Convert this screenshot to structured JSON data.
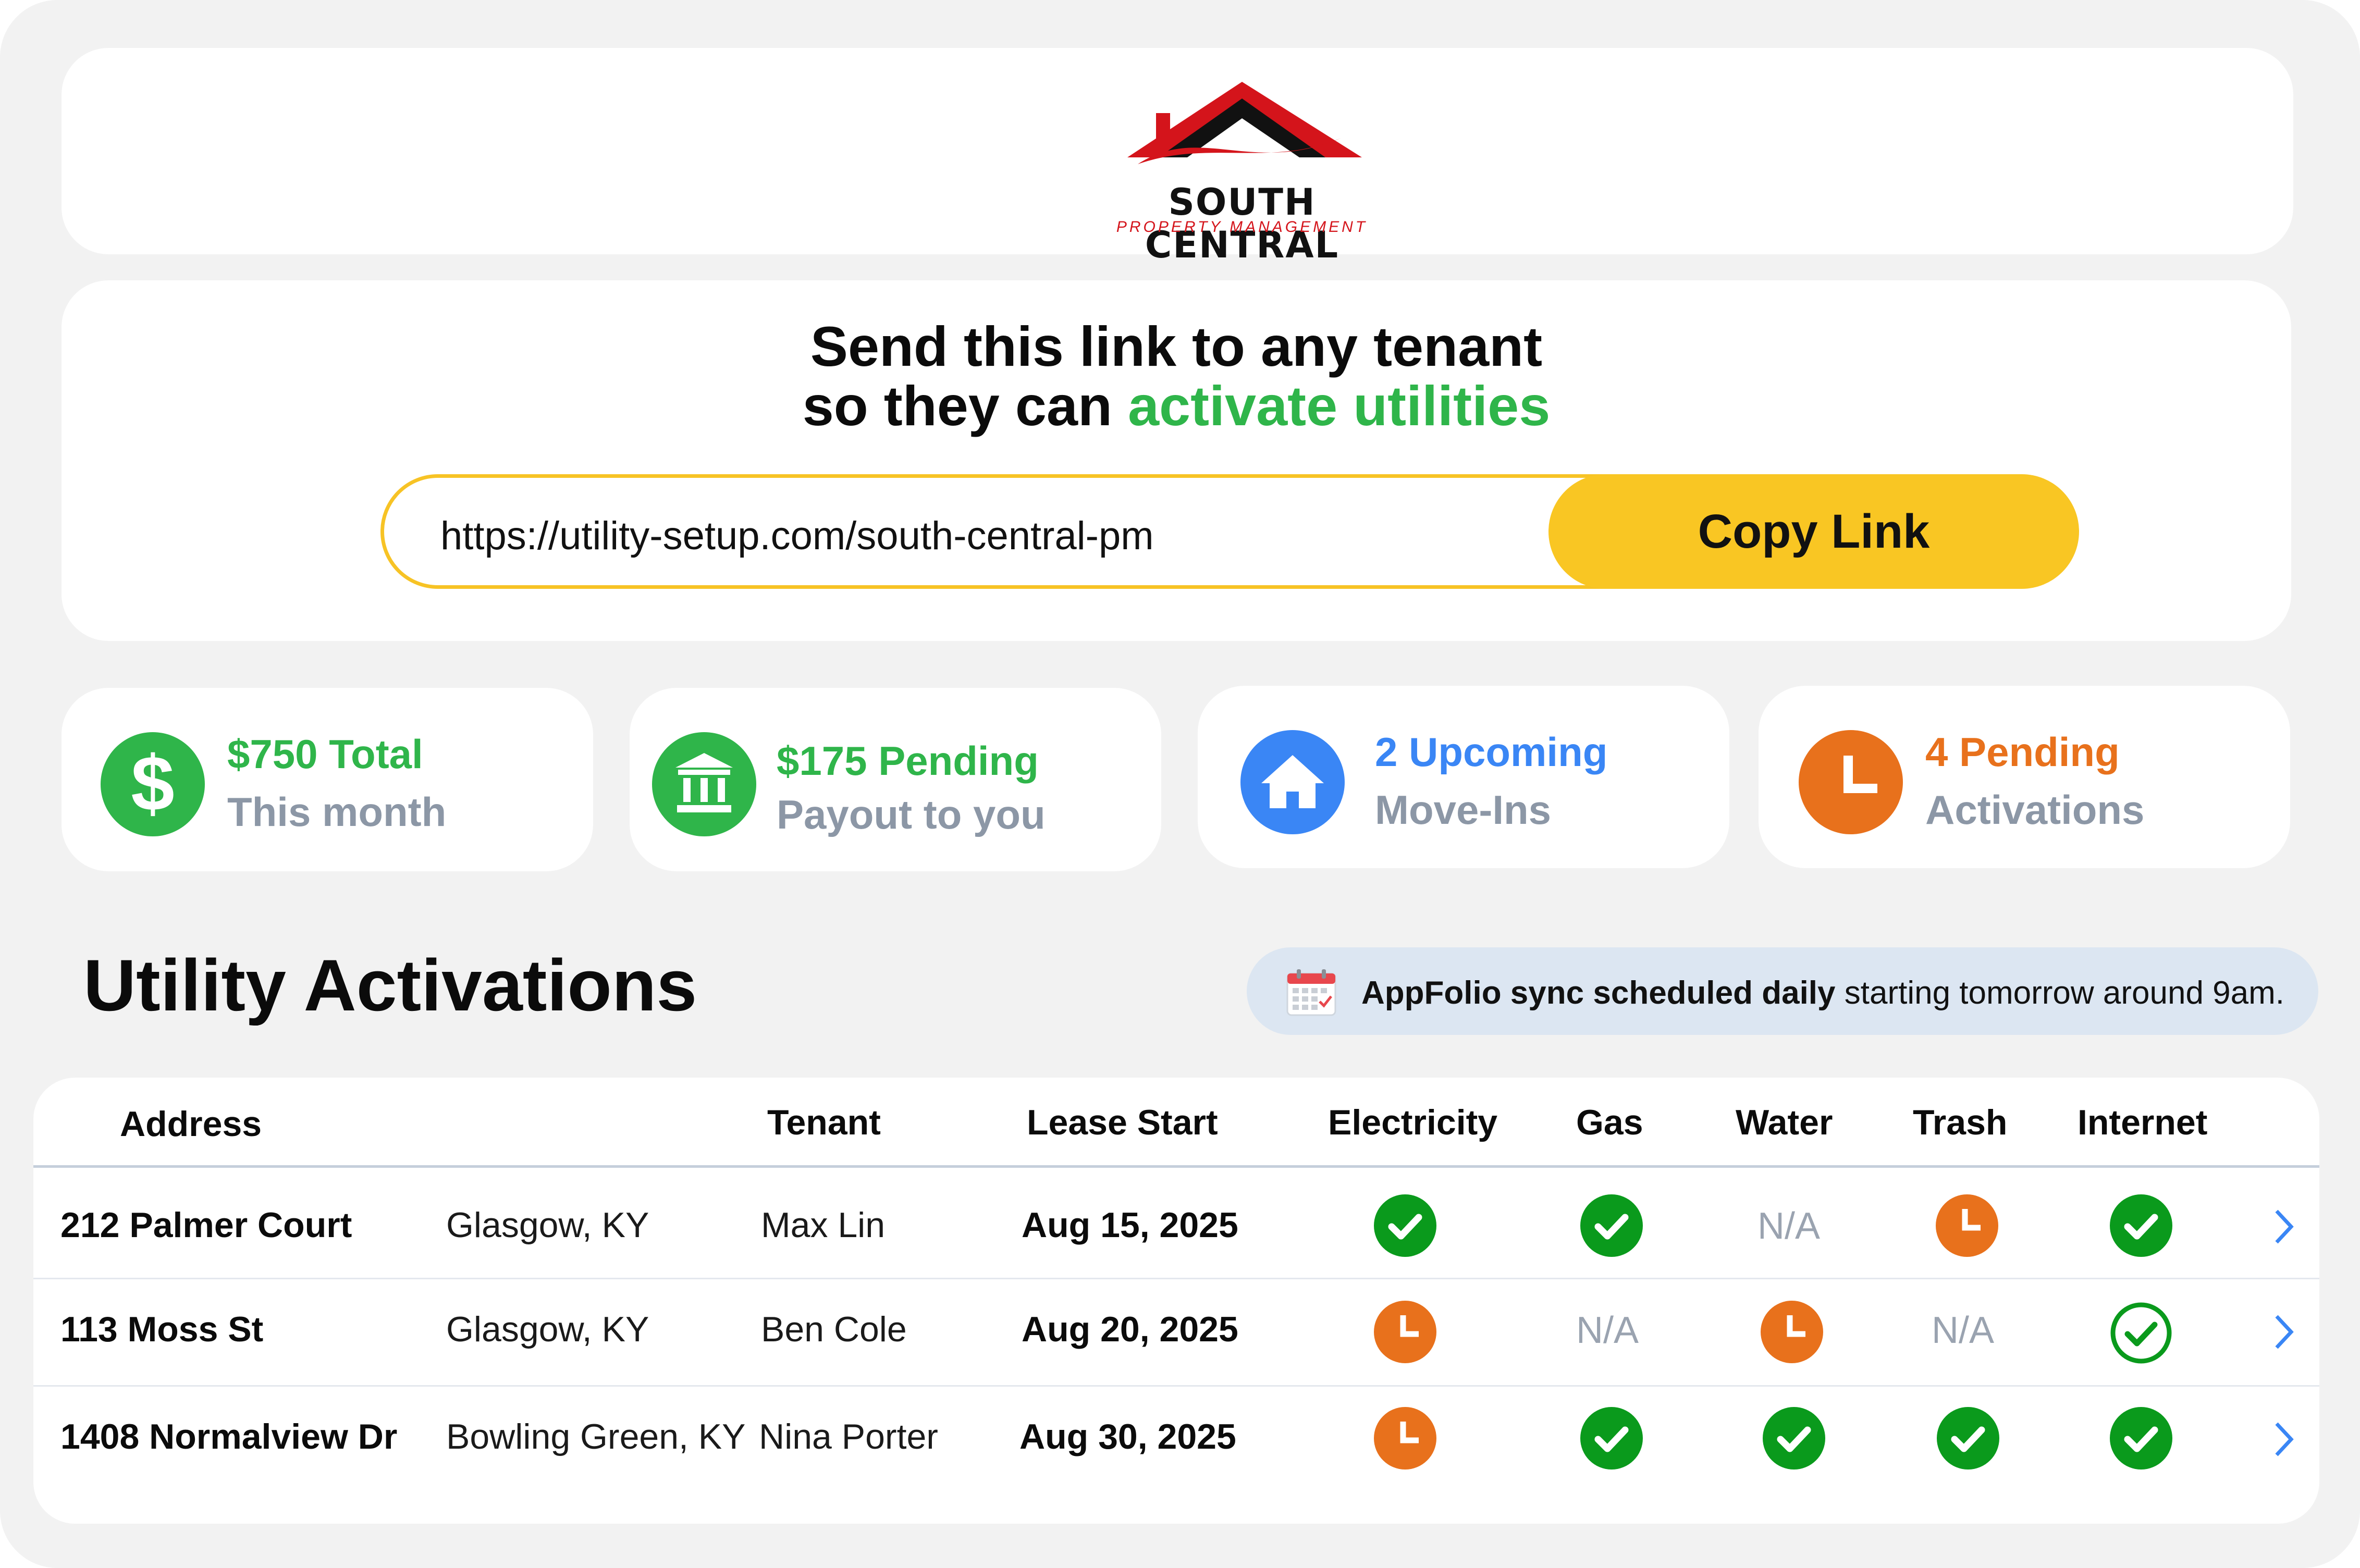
{
  "brand": {
    "line1": "SOUTH CENTRAL",
    "line2": "PROPERTY MANAGEMENT",
    "colors": {
      "roof": "#d4141b",
      "frame": "#111111"
    }
  },
  "link_section": {
    "headline_line1": "Send this link to any tenant",
    "headline_line2_prefix": "so they can ",
    "headline_line2_accent": "activate utilities",
    "url": "https://utility-setup.com/south-central-pm",
    "copy_button": "Copy Link"
  },
  "stats": [
    {
      "icon": "dollar-icon",
      "value": "$750 Total",
      "label": "This month",
      "color": "#2fb54a"
    },
    {
      "icon": "bank-icon",
      "value": "$175 Pending",
      "label": "Payout to you",
      "color": "#2fb54a"
    },
    {
      "icon": "house-icon",
      "value": "2 Upcoming",
      "label": "Move-Ins",
      "color": "#3a86f5"
    },
    {
      "icon": "clock-icon",
      "value": "4 Pending",
      "label": "Activations",
      "color": "#e8711c"
    }
  ],
  "section_title": "Utility Activations",
  "sync_banner": {
    "icon": "calendar-icon",
    "bold": "AppFolio sync scheduled daily",
    "rest": " starting tomorrow around 9am."
  },
  "table": {
    "headers": {
      "address": "Address",
      "tenant": "Tenant",
      "lease_start": "Lease Start",
      "electricity": "Electricity",
      "gas": "Gas",
      "water": "Water",
      "trash": "Trash",
      "internet": "Internet"
    },
    "na_text": "N/A",
    "rows": [
      {
        "street": "212 Palmer Court",
        "city": "Glasgow, KY",
        "tenant": "Max Lin",
        "lease_start": "Aug 15, 2025",
        "electricity": "done",
        "gas": "done",
        "water": "na",
        "trash": "pending",
        "internet": "done"
      },
      {
        "street": "113 Moss St",
        "city": "Glasgow, KY",
        "tenant": "Ben Cole",
        "lease_start": "Aug 20, 2025",
        "electricity": "pending",
        "gas": "na",
        "water": "pending",
        "trash": "na",
        "internet": "done-outline"
      },
      {
        "street": "1408 Normalview Dr",
        "city": "Bowling Green, KY",
        "tenant": "Nina Porter",
        "lease_start": "Aug 30, 2025",
        "electricity": "pending",
        "gas": "done",
        "water": "done",
        "trash": "done",
        "internet": "done"
      }
    ]
  },
  "colors": {
    "done": "#0a9a1c",
    "pending": "#e8711c",
    "accent_green": "#2fb54a",
    "accent_blue": "#3a86f5",
    "button_yellow": "#f9c623",
    "chevron": "#3a86f5"
  }
}
